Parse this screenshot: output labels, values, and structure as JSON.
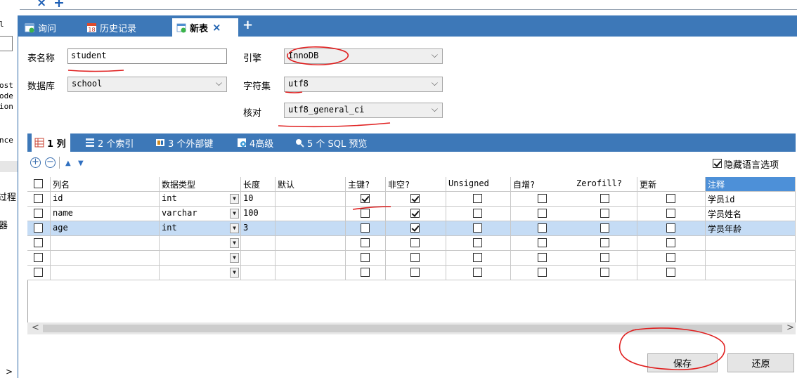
{
  "top_strip": {
    "close_glyph": "×",
    "add_glyph": "+"
  },
  "left_pane": {
    "fragments": [
      "l",
      "ost",
      "ode",
      "ion",
      "nce"
    ],
    "fragments_cn": [
      "过程",
      "器"
    ],
    "scroll_glyph": ">"
  },
  "tabs": [
    {
      "label": "询问"
    },
    {
      "label": "历史记录",
      "icon_badge": "18"
    },
    {
      "label": "新表",
      "close": "×"
    }
  ],
  "add_tab": "+",
  "form": {
    "table_name_label": "表名称",
    "table_name_value": "student",
    "database_label": "数据库",
    "database_value": "school",
    "engine_label": "引擎",
    "engine_value": "InnoDB",
    "charset_label": "字符集",
    "charset_value": "utf8",
    "collation_label": "核对",
    "collation_value": "utf8_general_ci"
  },
  "sub_tabs": [
    {
      "label": "1 列"
    },
    {
      "label": "2 个索引"
    },
    {
      "label": "3 个外部键"
    },
    {
      "label": "4高级"
    },
    {
      "label": "5 个 SQL 预览"
    }
  ],
  "toolbar": {
    "add_glyph": "+",
    "remove_glyph": "−",
    "up_glyph": "▲",
    "down_glyph": "▼",
    "hide_lang_label": "隐藏语言选项"
  },
  "grid": {
    "headers": [
      "列名",
      "数据类型",
      "长度",
      "默认",
      "主键?",
      "非空?",
      "Unsigned",
      "自增?",
      "Zerofill?",
      "更新",
      "注释"
    ],
    "rows": [
      {
        "name": "id",
        "type": "int",
        "length": "10",
        "default": "",
        "pk": true,
        "notnull": true,
        "unsigned": false,
        "autoinc": false,
        "zerofill": false,
        "update": false,
        "comment": "学员id"
      },
      {
        "name": "name",
        "type": "varchar",
        "length": "100",
        "default": "",
        "pk": false,
        "notnull": true,
        "unsigned": false,
        "autoinc": false,
        "zerofill": false,
        "update": false,
        "comment": "学员姓名"
      },
      {
        "name": "age",
        "type": "int",
        "length": "3",
        "default": "",
        "pk": false,
        "notnull": true,
        "unsigned": false,
        "autoinc": false,
        "zerofill": false,
        "update": false,
        "comment": "学员年龄"
      },
      {
        "name": "",
        "type": "",
        "length": "",
        "default": "",
        "pk": false,
        "notnull": false,
        "unsigned": false,
        "autoinc": false,
        "zerofill": false,
        "update": false,
        "comment": ""
      },
      {
        "name": "",
        "type": "",
        "length": "",
        "default": "",
        "pk": false,
        "notnull": false,
        "unsigned": false,
        "autoinc": false,
        "zerofill": false,
        "update": false,
        "comment": ""
      },
      {
        "name": "",
        "type": "",
        "length": "",
        "default": "",
        "pk": false,
        "notnull": false,
        "unsigned": false,
        "autoinc": false,
        "zerofill": false,
        "update": false,
        "comment": ""
      }
    ],
    "scroll_left": "<",
    "scroll_right": ">"
  },
  "buttons": {
    "save": "保存",
    "revert": "还原"
  },
  "colors": {
    "accent": "#3d78b8",
    "selected_row": "#c5dcf5",
    "comment_header": "#4d90d8",
    "annotation": "#e02020"
  }
}
